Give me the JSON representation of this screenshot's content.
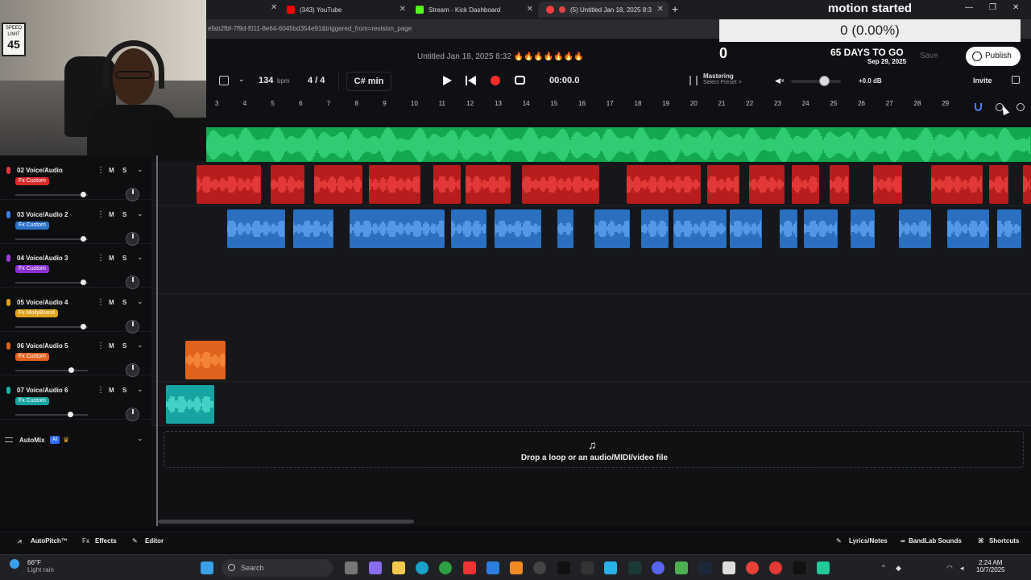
{
  "browser": {
    "tabs": [
      {
        "label": "(343) YouTube",
        "color": "#ff0000"
      },
      {
        "label": "Stream - Kick Dashboard",
        "color": "#53fc18"
      },
      {
        "label": "(5) Untitled Jan 18, 2025 8:3",
        "color": "#ff3b3b"
      }
    ],
    "url": "efab2fbf-7f9d-f011-8e64-6045bd354e91&triggered_from=revision_page"
  },
  "overlay": {
    "title": "motion started",
    "progress": "0 (0.00%)",
    "count": "0",
    "days": "65 DAYS TO GO",
    "date": "Sep 29, 2025"
  },
  "header": {
    "project_title": "Untitled Jan 18, 2025 8:32 🔥🔥🔥🔥🔥🔥🔥",
    "save_label": "Save",
    "publish_label": "Publish"
  },
  "transport": {
    "bpm": "134",
    "bpm_unit": "bpm",
    "time_sig": "4 / 4",
    "key": "C# min",
    "timecode": "00:00.0",
    "mastering_label": "Mastering",
    "mastering_preset": "Select Preset >",
    "volume_db": "+0.0 dB",
    "volume_level": 0.62,
    "invite_label": "Invite"
  },
  "ruler": [
    "3",
    "4",
    "5",
    "6",
    "7",
    "8",
    "9",
    "10",
    "11",
    "12",
    "13",
    "14",
    "15",
    "16",
    "17",
    "18",
    "19",
    "20",
    "21",
    "22",
    "23",
    "24",
    "25",
    "26",
    "27",
    "28",
    "29"
  ],
  "tracks": [
    {
      "name": "02 Voice/Audio",
      "fx": "Fx Custom",
      "fx_color": "#d92b2b",
      "color": "#e03a3a",
      "fader": 0.94
    },
    {
      "name": "03 Voice/Audio 2",
      "fx": "Fx Custom",
      "fx_color": "#2b72c9",
      "color": "#3b7fe0",
      "fader": 0.94
    },
    {
      "name": "04 Voice/Audio 3",
      "fx": "Fx Custom",
      "fx_color": "#8a2fd0",
      "color": "#9b3fe0",
      "fader": 0.94
    },
    {
      "name": "05 Voice/Audio 4",
      "fx": "Fx MollyBrand",
      "fx_color": "#e0a21d",
      "color": "#e0a21d",
      "fader": 0.94
    },
    {
      "name": "06 Voice/Audio 5",
      "fx": "Fx Custom",
      "fx_color": "#e0621d",
      "color": "#e0621d",
      "fader": 0.78
    },
    {
      "name": "07 Voice/Audio 6",
      "fx": "Fx Custom",
      "fx_color": "#16a3a1",
      "color": "#18b5a8",
      "fader": 0.77
    }
  ],
  "automix": {
    "label": "AutoMix",
    "ai": "AI"
  },
  "drop_text": "Drop a loop or an audio/MIDI/video file",
  "bottom": {
    "autopitch": "AutoPitch™",
    "effects": "Effects",
    "editor": "Editor",
    "lyrics": "Lyrics/Notes",
    "sounds": "BandLab Sounds",
    "shortcuts": "Shortcuts"
  },
  "taskbar": {
    "temp": "66°F",
    "weather": "Light rain",
    "search": "Search",
    "time": "2:24 AM",
    "date": "10/7/2025"
  },
  "webcam": {
    "sign_top": "SPEED LIMIT",
    "sign_num": "45"
  }
}
